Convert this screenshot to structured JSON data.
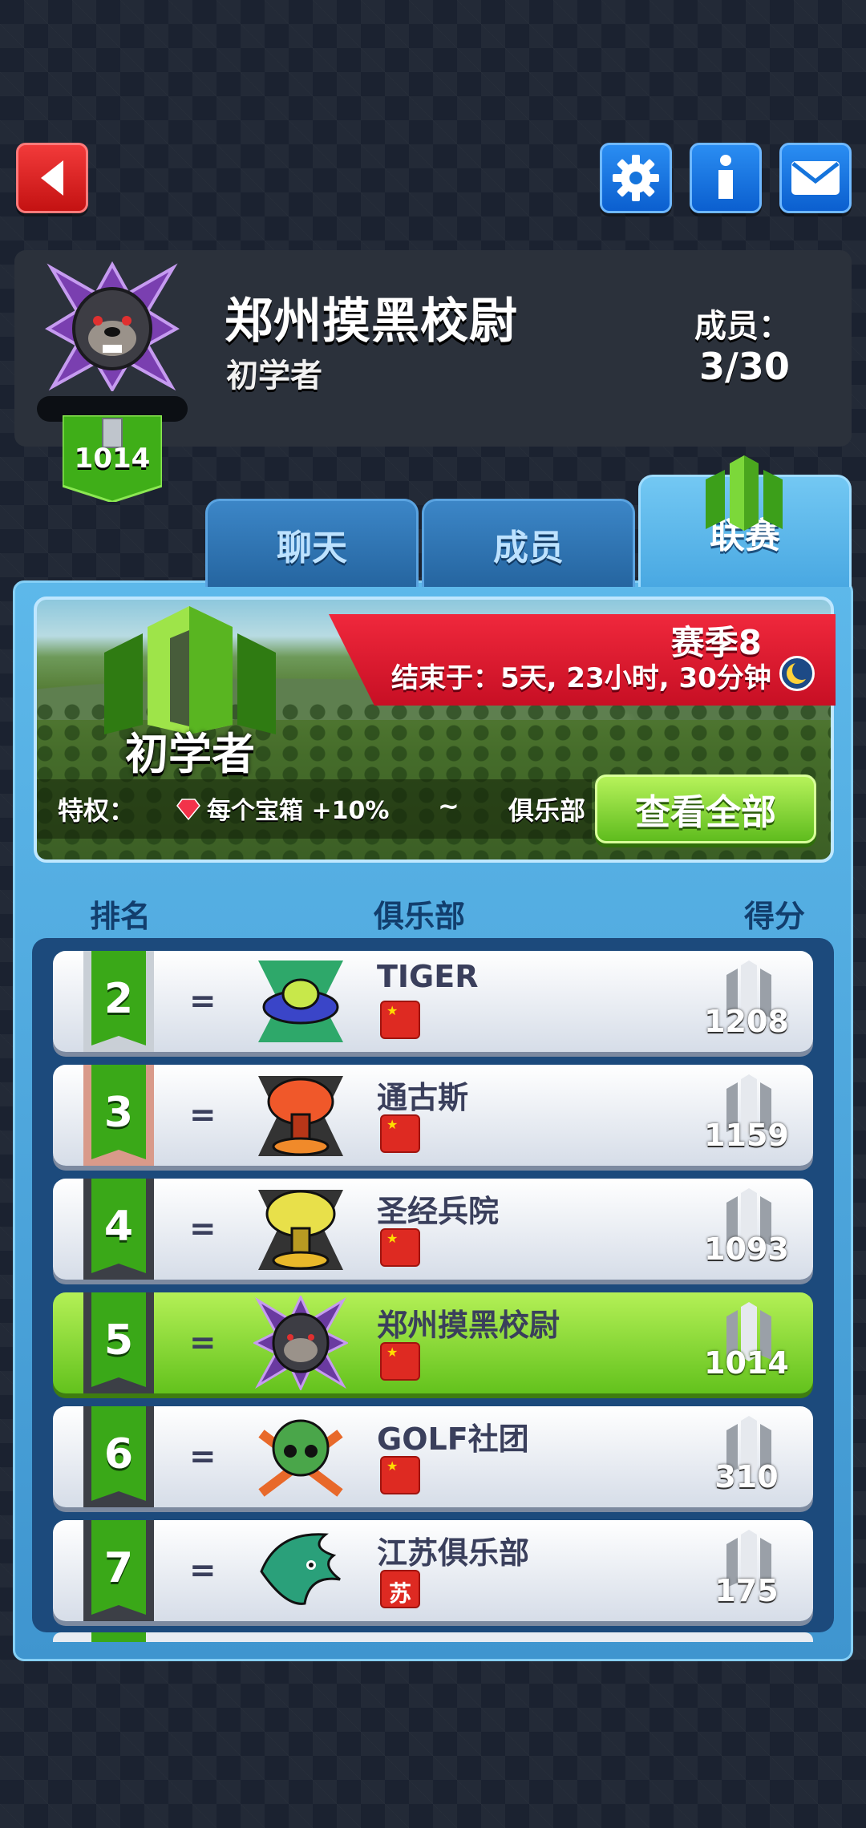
{
  "header": {
    "back_icon": "back-arrow-icon",
    "settings_icon": "gear-icon",
    "info_icon": "info-icon",
    "mail_icon": "mail-icon"
  },
  "club": {
    "name": "郑州摸黑校尉",
    "league": "初学者",
    "members_label": "成员：",
    "members_value": "3/30",
    "trophies": "1014"
  },
  "tabs": {
    "chat": "聊天",
    "members": "成员",
    "league": "联赛"
  },
  "league_banner": {
    "league_name": "初学者",
    "season": "赛季8",
    "ends_in": "结束于：5天, 23小时, 30分钟",
    "perks_label": "特权：",
    "perk": "每个宝箱 +10%",
    "perk_sep": "~",
    "perk_scope": "俱乐部",
    "view_all": "查看全部"
  },
  "columns": {
    "rank": "排名",
    "club": "俱乐部",
    "score": "得分"
  },
  "rankings": [
    {
      "rank": "2",
      "change": "=",
      "name": "TIGER",
      "flag": "cn",
      "score": "1208",
      "icon": "ufo-icon",
      "mine": false
    },
    {
      "rank": "3",
      "change": "=",
      "name": "通古斯",
      "flag": "cn",
      "score": "1159",
      "icon": "explosion-icon",
      "mine": false
    },
    {
      "rank": "4",
      "change": "=",
      "name": "圣经兵院",
      "flag": "cn",
      "score": "1093",
      "icon": "mushroom-cloud-icon",
      "mine": false
    },
    {
      "rank": "5",
      "change": "=",
      "name": "郑州摸黑校尉",
      "flag": "cn",
      "score": "1014",
      "icon": "bulldog-icon",
      "mine": true
    },
    {
      "rank": "6",
      "change": "=",
      "name": "GOLF社团",
      "flag": "cn",
      "score": "310",
      "icon": "skull-clubs-icon",
      "mine": false
    },
    {
      "rank": "7",
      "change": "=",
      "name": "江苏俱乐部",
      "flag": "苏",
      "score": "175",
      "icon": "eagle-icon",
      "mine": false
    }
  ],
  "colors": {
    "accent_green": "#63c21d",
    "accent_red": "#c70f24",
    "accent_blue": "#49a8e2"
  }
}
